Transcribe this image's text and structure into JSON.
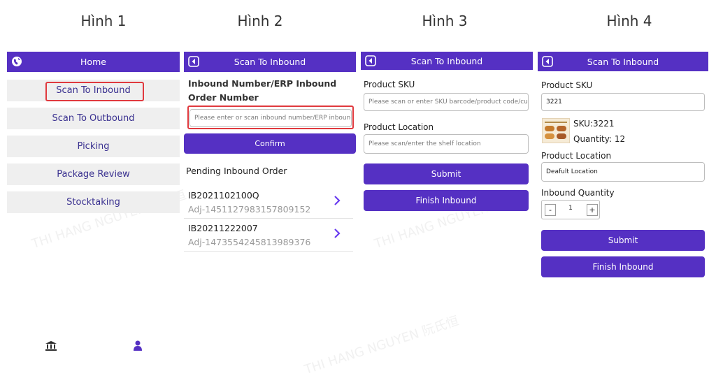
{
  "figure_titles": [
    "Hình 1",
    "Hình 2",
    "Hình 3",
    "Hình 4"
  ],
  "watermark": "THI HANG NGUYEN 阮氏恒",
  "colors": {
    "primary": "#5530c3",
    "highlight": "#e0393e",
    "menu_bg": "#efefef"
  },
  "screen1": {
    "header_title": "Home",
    "header_icon": "globe-icon",
    "menu": [
      "Scan To Inbound",
      "Scan To Outbound",
      "Picking",
      "Package Review",
      "Stocktaking"
    ],
    "bottom_nav_icons": [
      "bank-icon",
      "user-icon"
    ]
  },
  "screen2": {
    "header_title": "Scan To Inbound",
    "field_label": "Inbound Number/ERP Inbound Order Number",
    "field_placeholder": "Please enter or scan inbound number/ERP inbound order number",
    "confirm_label": "Confirm",
    "pending_title": "Pending Inbound Order",
    "pending_orders": [
      {
        "number": "IB2021102100Q",
        "adj": "Adj-1451127983157809152"
      },
      {
        "number": "IB20211222007",
        "adj": "Adj-1473554245813989376"
      }
    ]
  },
  "screen3": {
    "header_title": "Scan To Inbound",
    "sku_label": "Product SKU",
    "sku_placeholder": "Please scan or enter SKU barcode/product code/custom code",
    "location_label": "Product Location",
    "location_placeholder": "Please scan/enter the shelf location",
    "submit_label": "Submit",
    "finish_label": "Finish Inbound"
  },
  "screen4": {
    "header_title": "Scan To Inbound",
    "sku_label": "Product SKU",
    "sku_value": "3221",
    "product_sku": "SKU:3221",
    "product_quantity": "Quantity: 12",
    "location_label": "Product Location",
    "location_value": "Deafult Location",
    "quantity_label": "Inbound Quantity",
    "quantity_minus": "-",
    "quantity_value": "1",
    "quantity_plus": "+",
    "submit_label": "Submit",
    "finish_label": "Finish Inbound"
  }
}
